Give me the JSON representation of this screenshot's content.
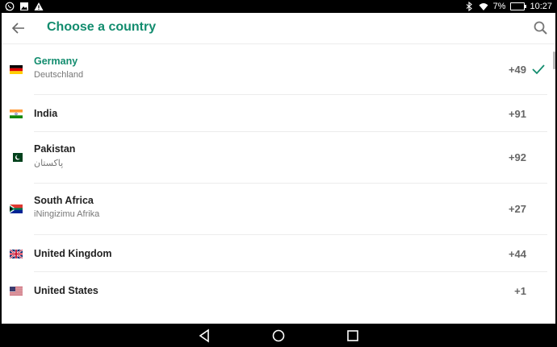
{
  "status": {
    "battery": "7%",
    "time": "10:27"
  },
  "toolbar": {
    "title": "Choose a country"
  },
  "countries": [
    {
      "name": "Germany",
      "native": "Deutschland",
      "code": "+49",
      "selected": true,
      "flag": "flag-germany"
    },
    {
      "name": "India",
      "native": "",
      "code": "+91",
      "selected": false,
      "flag": "flag-india"
    },
    {
      "name": "Pakistan",
      "native": "پاکستان",
      "code": "+92",
      "selected": false,
      "flag": "flag-pakistan"
    },
    {
      "name": "South Africa",
      "native": "iNingizimu Afrika",
      "code": "+27",
      "selected": false,
      "flag": "flag-south-africa"
    },
    {
      "name": "United Kingdom",
      "native": "",
      "code": "+44",
      "selected": false,
      "flag": "flag-united-kingdom"
    },
    {
      "name": "United States",
      "native": "",
      "code": "+1",
      "selected": false,
      "flag": "flag-united-states"
    }
  ],
  "colors": {
    "accent": "#128c6e",
    "text": "#222222",
    "secondary": "#777777"
  }
}
